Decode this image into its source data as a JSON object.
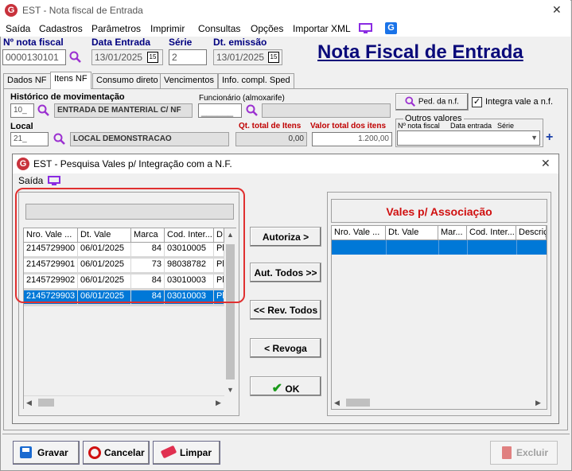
{
  "window": {
    "title": "EST - Nota fiscal de Entrada",
    "app_badge": "G"
  },
  "menu": {
    "items": [
      "Saída",
      "Cadastros",
      "Parâmetros",
      "Imprimir",
      "Consultas",
      "Opções",
      "Importar XML"
    ]
  },
  "header": {
    "nota_label": "Nº nota fiscal",
    "nota_value": "0000130101",
    "data_entrada_label": "Data Entrada",
    "data_entrada_value": "13/01/2025",
    "serie_label": "Série",
    "serie_value": "2",
    "dt_emissao_label": "Dt. emissão",
    "dt_emissao_value": "13/01/2025",
    "calendar_glyph": "15",
    "big_title": "Nota Fiscal de Entrada"
  },
  "tabs": [
    "Dados NF",
    "Itens NF",
    "Consumo direto",
    "Vencimentos",
    "Info. compl. Sped"
  ],
  "itens": {
    "historico_label": "Histórico de movimentação",
    "historico_code": "10_",
    "historico_desc": "ENTRADA DE MANTERIAL C/ NF",
    "funcionario_label": "Funcionário (almoxarife)",
    "funcionario_code": "______",
    "funcionario_desc": "",
    "ped_button": "Ped. da n.f.",
    "integra_label": "Integra vale a n.f.",
    "integra_checked": true,
    "local_label": "Local",
    "local_code": "21_",
    "local_desc": "LOCAL DEMONSTRACAO",
    "qt_total_label": "Qt. total de Itens",
    "qt_total_value": "0,00",
    "valor_total_label": "Valor total dos itens",
    "valor_total_value": "1.200,00",
    "outros_label": "Outros valores",
    "outros_cols": [
      "Nº nota fiscal",
      "Data entrada",
      "Série"
    ],
    "add_glyph": "+"
  },
  "dialog": {
    "title": "EST - Pesquisa Vales p/ Integração com a N.F.",
    "menu_saida": "Saída",
    "close_glyph": "✕",
    "search_value": "",
    "left_grid": {
      "columns": [
        "Nro. Vale ...",
        "Dt. Vale",
        "Marca",
        "Cod. Inter...",
        "D"
      ],
      "rows": [
        [
          "2145729900",
          "06/01/2025",
          "84",
          "03010005",
          "Pl"
        ],
        [
          "2145729901",
          "06/01/2025",
          "73",
          "98038782",
          "Pl"
        ],
        [
          "2145729902",
          "06/01/2025",
          "84",
          "03010003",
          "Pl"
        ],
        [
          "2145729903",
          "06/01/2025",
          "84",
          "03010003",
          "Pl"
        ]
      ],
      "selected_row": 3
    },
    "buttons": {
      "autoriza": "Autoriza >",
      "aut_todos": "Aut. Todos >>",
      "rev_todos": "<< Rev. Todos",
      "revoga": "< Revoga",
      "ok": "OK"
    },
    "right_title": "Vales p/ Associação",
    "right_grid": {
      "columns": [
        "Nro. Vale ...",
        "Dt. Vale",
        "Mar...",
        "Cod. Inter...",
        "Descriç"
      ]
    }
  },
  "footer": {
    "gravar": "Gravar",
    "cancelar": "Cancelar",
    "limpar": "Limpar",
    "excluir": "Excluir"
  },
  "colors": {
    "accent_red": "#c8323c",
    "title_blue": "#0a0a7a",
    "selection": "#0078d7",
    "highlight_box": "#e03030",
    "label_red": "#c00000"
  }
}
